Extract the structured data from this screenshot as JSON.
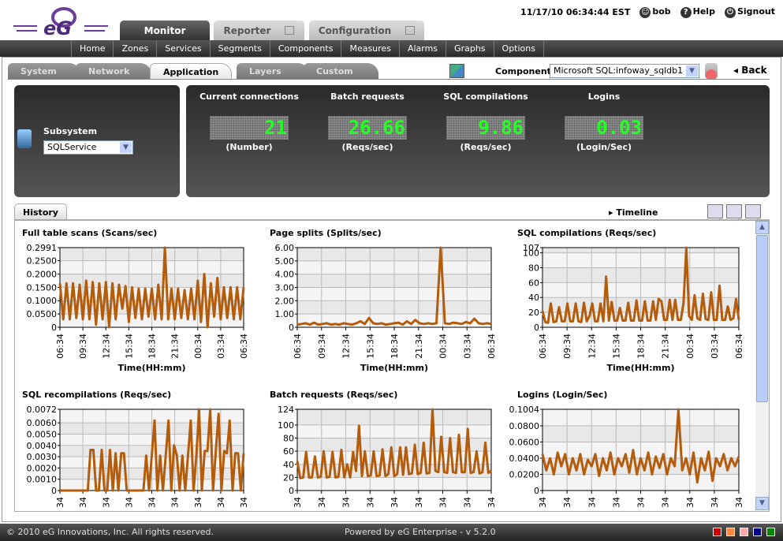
{
  "header": {
    "datetime": "11/17/10 06:34:44 EST",
    "user": "bob",
    "help": "Help",
    "signout": "Signout",
    "logo": "eG"
  },
  "top_tabs": [
    {
      "label": "Monitor"
    },
    {
      "label": "Reporter"
    },
    {
      "label": "Configuration"
    }
  ],
  "nav": [
    "Home",
    "Zones",
    "Services",
    "Segments",
    "Components",
    "Measures",
    "Alarms",
    "Graphs",
    "Options"
  ],
  "sub_tabs": [
    "System",
    "Network",
    "Application",
    "Layers",
    "Custom"
  ],
  "component": {
    "label": "Component",
    "value": "Microsoft SQL:infoway_sqldb1",
    "back": "Back"
  },
  "subsystem": {
    "label": "Subsystem",
    "value": "SQLService"
  },
  "metrics": [
    {
      "name": "Current connections",
      "value": "21",
      "unit": "(Number)"
    },
    {
      "name": "Batch requests",
      "value": "26.66",
      "unit": "(Reqs/sec)"
    },
    {
      "name": "SQL compilations",
      "value": "9.86",
      "unit": "(Reqs/sec)"
    },
    {
      "name": "Logins",
      "value": "0.03",
      "unit": "(Login/Sec)"
    }
  ],
  "history": {
    "tab": "History",
    "timeline": "Timeline"
  },
  "colors": {
    "series": "#b35c0c",
    "accent_green": "#22ff22"
  },
  "chart_data": [
    {
      "type": "line",
      "title": "Full table scans (Scans/sec)",
      "xlabel": "Time(HH:mm)",
      "ylim": [
        0,
        0.2991
      ],
      "yticks": [
        "0",
        "0.0500",
        "0.1000",
        "0.1500",
        "0.2000",
        "0.2500",
        "0.2991"
      ],
      "ytick_vals": [
        0,
        0.05,
        0.1,
        0.15,
        0.2,
        0.25,
        0.2991
      ],
      "x_ticks": [
        "06:34",
        "09:34",
        "12:34",
        "15:34",
        "18:34",
        "21:34",
        "00:34",
        "03:34",
        "06:34"
      ],
      "values": [
        0.165,
        0.03,
        0.165,
        0.03,
        0.165,
        0.035,
        0.16,
        0.03,
        0.175,
        0.03,
        0.17,
        0.01,
        0.165,
        0.03,
        0.17,
        0.0,
        0.165,
        0.03,
        0.16,
        0.07,
        0.155,
        0.02,
        0.15,
        0.035,
        0.145,
        0.03,
        0.145,
        0.04,
        0.145,
        0.03,
        0.16,
        0.03,
        0.2991,
        0.03,
        0.145,
        0.03,
        0.145,
        0.035,
        0.14,
        0.03,
        0.145,
        0.03,
        0.175,
        0.02,
        0.2,
        0.0,
        0.165,
        0.04,
        0.185,
        0.03,
        0.15,
        0.035,
        0.15,
        0.03,
        0.15,
        0.03,
        0.15
      ]
    },
    {
      "type": "line",
      "title": "Page splits (Splits/sec)",
      "xlabel": "Time(HH:mm)",
      "ylim": [
        0,
        6
      ],
      "yticks": [
        "0",
        "1.00",
        "2.00",
        "3.00",
        "4.00",
        "5.00",
        "6.00"
      ],
      "ytick_vals": [
        0,
        1,
        2,
        3,
        4,
        5,
        6
      ],
      "x_ticks": [
        "06:34",
        "09:34",
        "12:34",
        "15:34",
        "18:34",
        "21:34",
        "00:34",
        "03:34",
        "06:34"
      ],
      "values": [
        0.2,
        0.25,
        0.3,
        0.2,
        0.35,
        0.2,
        0.25,
        0.3,
        0.2,
        0.25,
        0.2,
        0.3,
        0.25,
        0.2,
        0.3,
        0.45,
        0.25,
        0.7,
        0.3,
        0.25,
        0.3,
        0.2,
        0.25,
        0.3,
        0.35,
        0.2,
        0.45,
        0.25,
        0.55,
        0.3,
        0.25,
        0.3,
        0.25,
        0.3,
        6.0,
        0.3,
        0.25,
        0.35,
        0.3,
        0.25,
        0.4,
        0.3,
        0.65,
        0.3,
        0.25,
        0.3,
        0.25
      ]
    },
    {
      "type": "line",
      "title": "SQL compilations (Reqs/sec)",
      "xlabel": "Time(HH:mm)",
      "ylim": [
        0,
        107
      ],
      "yticks": [
        "0",
        "20",
        "40",
        "60",
        "80",
        "100",
        "107"
      ],
      "ytick_vals": [
        0,
        20,
        40,
        60,
        80,
        100,
        107
      ],
      "x_ticks": [
        "06:34",
        "09:34",
        "12:34",
        "15:34",
        "18:34",
        "21:34",
        "00:34",
        "03:34",
        "06:34"
      ],
      "values": [
        22,
        7,
        6,
        32,
        7,
        8,
        27,
        8,
        8,
        32,
        8,
        8,
        32,
        8,
        7,
        33,
        8,
        15,
        32,
        8,
        8,
        32,
        8,
        68,
        9,
        34,
        9,
        9,
        26,
        9,
        9,
        33,
        9,
        9,
        36,
        9,
        9,
        35,
        9,
        9,
        35,
        10,
        38,
        35,
        10,
        10,
        37,
        10,
        37,
        10,
        10,
        33,
        107,
        15,
        10,
        43,
        12,
        10,
        45,
        11,
        10,
        47,
        10,
        10,
        56,
        10,
        10,
        28,
        10,
        12,
        38,
        10
      ]
    },
    {
      "type": "line",
      "title": "SQL recompilations (Reqs/sec)",
      "ylim": [
        0,
        0.0072
      ],
      "yticks": [
        "0",
        "0.0010",
        "0.0020",
        "0.0030",
        "0.0040",
        "0.0050",
        "0.0060",
        "0.0072"
      ],
      "ytick_vals": [
        0,
        0.001,
        0.002,
        0.003,
        0.004,
        0.005,
        0.006,
        0.0072
      ],
      "x_ticks": [
        "34",
        "34",
        "34",
        "34",
        "34",
        "34",
        "34",
        "34",
        "34"
      ],
      "values": [
        0,
        0,
        0,
        0,
        0,
        0,
        0,
        0,
        0,
        0,
        0,
        0.0036,
        0.0036,
        0,
        0,
        0.0036,
        0,
        0,
        0.0036,
        0,
        0.0033,
        0,
        0.0033,
        0.0033,
        0,
        0,
        0,
        0,
        0,
        0,
        0,
        0.0031,
        0,
        0.0031,
        0.0062,
        0,
        0.0031,
        0,
        0.0031,
        0.0062,
        0,
        0.004,
        0.0031,
        0,
        0.0031,
        0,
        0.0031,
        0.0062,
        0,
        0.0031,
        0.0072,
        0,
        0.0035,
        0.0035,
        0.0072,
        0,
        0.0035,
        0.0068,
        0,
        0.0035,
        0.0033,
        0.0062,
        0,
        0.0033,
        0.0033,
        0,
        0.0033
      ]
    },
    {
      "type": "line",
      "title": "Batch requests (Reqs/sec)",
      "ylim": [
        0,
        124
      ],
      "yticks": [
        "0",
        "20",
        "40",
        "60",
        "80",
        "100",
        "124"
      ],
      "ytick_vals": [
        0,
        20,
        40,
        60,
        80,
        100,
        124
      ],
      "x_ticks": [
        "34",
        "34",
        "34",
        "34",
        "34",
        "34",
        "34",
        "34",
        "34"
      ],
      "values": [
        45,
        19,
        20,
        59,
        20,
        20,
        52,
        20,
        21,
        60,
        20,
        21,
        59,
        20,
        21,
        62,
        20,
        40,
        20,
        59,
        30,
        99,
        22,
        60,
        22,
        23,
        60,
        22,
        23,
        63,
        22,
        25,
        66,
        22,
        25,
        66,
        24,
        66,
        25,
        26,
        70,
        25,
        27,
        73,
        26,
        27,
        124,
        30,
        28,
        82,
        28,
        27,
        80,
        28,
        27,
        85,
        28,
        28,
        94,
        27,
        28,
        60,
        26,
        28,
        73,
        27,
        30
      ]
    },
    {
      "type": "line",
      "title": "Logins (Login/Sec)",
      "ylim": [
        0,
        0.1004
      ],
      "yticks": [
        "0",
        "0.0200",
        "0.0400",
        "0.0600",
        "0.0800",
        "0.1004"
      ],
      "ytick_vals": [
        0,
        0.02,
        0.04,
        0.06,
        0.08,
        0.1004
      ],
      "x_ticks": [
        "34",
        "34",
        "34",
        "34",
        "34",
        "34",
        "34",
        "34",
        "34"
      ],
      "values": [
        0.045,
        0.025,
        0.04,
        0.02,
        0.047,
        0.03,
        0.045,
        0.02,
        0.04,
        0.025,
        0.045,
        0.02,
        0.038,
        0.03,
        0.045,
        0.018,
        0.04,
        0.025,
        0.047,
        0.02,
        0.04,
        0.03,
        0.045,
        0.022,
        0.05,
        0.02,
        0.04,
        0.025,
        0.047,
        0.02,
        0.042,
        0.028,
        0.045,
        0.02,
        0.04,
        0.03,
        0.1004,
        0.025,
        0.04,
        0.02,
        0.047,
        0.01,
        0.04,
        0.025,
        0.048,
        0.012,
        0.04,
        0.03,
        0.045,
        0.025,
        0.04,
        0.03,
        0.042
      ]
    }
  ],
  "footer": {
    "copyright": "© 2010 eG Innovations, Inc. All rights reserved.",
    "powered": "Powered by eG Enterprise  - v 5.2.0",
    "theme_colors": [
      "#cc0000",
      "#ff8844",
      "#ffaaaa",
      "#000088",
      "#008800"
    ]
  }
}
